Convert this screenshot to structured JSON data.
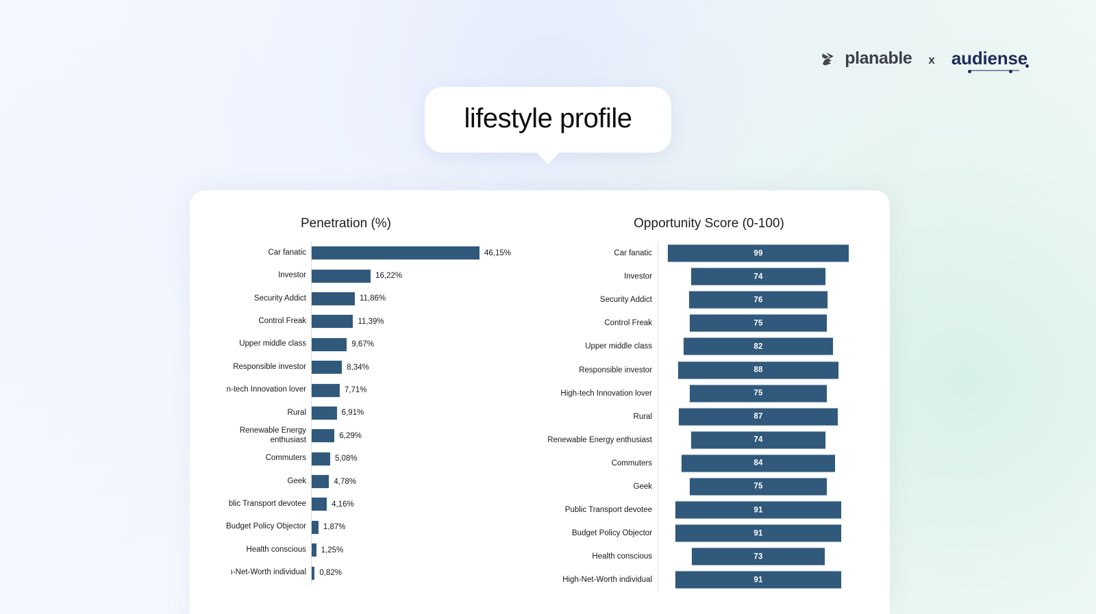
{
  "header": {
    "planable_name": "planable",
    "separator": "x",
    "audiense_name": "audiense",
    "planable_icon": "paper-plane-icon"
  },
  "title_bubble": {
    "text": "lifestyle profile"
  },
  "chart_data": [
    {
      "type": "bar",
      "orientation": "horizontal",
      "title": "Penetration (%)",
      "xlabel": "",
      "ylabel": "",
      "grid": false,
      "legend": "none",
      "xlim": [
        0,
        46.15
      ],
      "value_suffix": "%",
      "decimal_separator": ",",
      "categories": [
        "Car fanatic",
        "Investor",
        "Security Addict",
        "Control Freak",
        "Upper middle class",
        "Responsible investor",
        "High-tech Innovation lover",
        "Rural",
        "Renewable Energy enthusiast",
        "Commuters",
        "Geek",
        "Public Transport devotee",
        "Budget Policy Objector",
        "Health conscious",
        "High-Net-Worth individual"
      ],
      "display_labels": [
        "Car fanatic",
        "Investor",
        "Security Addict",
        "Control Freak",
        "Upper middle class",
        "Responsible investor",
        "n-tech Innovation lover",
        "Rural",
        "Renewable Energy\nenthusiast",
        "Commuters",
        "Geek",
        "blic Transport devotee",
        "Budget Policy Objector",
        "Health conscious",
        "ı-Net-Worth individual"
      ],
      "values": [
        46.15,
        16.22,
        11.86,
        11.39,
        9.67,
        8.34,
        7.71,
        6.91,
        6.29,
        5.08,
        4.78,
        4.16,
        1.87,
        1.25,
        0.82
      ],
      "value_labels": [
        "46,15%",
        "16,22%",
        "11,86%",
        "11,39%",
        "9,67%",
        "8,34%",
        "7,71%",
        "6,91%",
        "6,29%",
        "5,08%",
        "4,78%",
        "4,16%",
        "1,87%",
        "1,25%",
        "0,82%"
      ]
    },
    {
      "type": "bar",
      "orientation": "horizontal",
      "bar_alignment": "centered",
      "title": "Opportunity Score (0-100)",
      "xlabel": "",
      "ylabel": "",
      "grid": false,
      "legend": "none",
      "xlim": [
        0,
        100
      ],
      "categories": [
        "Car fanatic",
        "Investor",
        "Security Addict",
        "Control Freak",
        "Upper middle class",
        "Responsible investor",
        "High-tech Innovation lover",
        "Rural",
        "Renewable Energy enthusiast",
        "Commuters",
        "Geek",
        "Public Transport devotee",
        "Budget Policy Objector",
        "Health conscious",
        "High-Net-Worth individual"
      ],
      "values": [
        99,
        74,
        76,
        75,
        82,
        88,
        75,
        87,
        74,
        84,
        75,
        91,
        91,
        73,
        91
      ],
      "value_labels": [
        "99",
        "74",
        "76",
        "75",
        "82",
        "88",
        "75",
        "87",
        "74",
        "84",
        "75",
        "91",
        "91",
        "73",
        "91"
      ]
    }
  ],
  "colors": {
    "bar": "#30597b",
    "bar_value_text": "#ffffff",
    "card_background": "#ffffff",
    "axis_line": "#d9dde3",
    "audiense_brand": "#1c2c5b",
    "planable_brand": "#3b3f4a"
  }
}
